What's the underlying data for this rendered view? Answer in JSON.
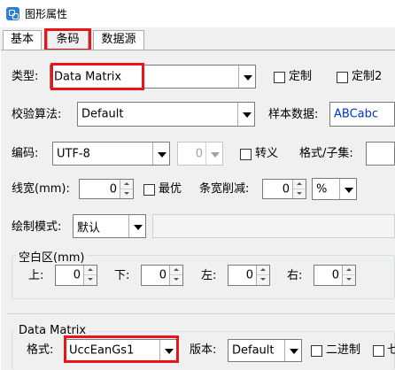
{
  "window": {
    "title": "图形属性"
  },
  "tabs": [
    {
      "label": "基本"
    },
    {
      "label": "条码"
    },
    {
      "label": "数据源"
    }
  ],
  "barcode": {
    "type_label": "类型:",
    "type_value": "Data Matrix",
    "custom_label": "定制",
    "custom2_label": "定制2",
    "check_label": "校验算法:",
    "check_value": "Default",
    "sample_label": "样本数据:",
    "sample_value": "ABCabc",
    "encoding_label": "编码:",
    "encoding_value": "UTF-8",
    "encoding_num": "0",
    "escape_label": "转义",
    "format_subset_label": "格式/子集:",
    "line_width_label": "线宽(mm):",
    "line_width_value": "0",
    "optimal_label": "最优",
    "bar_reduce_label": "条宽削减:",
    "bar_reduce_value": "0",
    "bar_reduce_unit": "%",
    "draw_mode_label": "绘制模式:",
    "draw_mode_value": "默认"
  },
  "quiet_zone": {
    "title": "空白区(mm)",
    "top_label": "上:",
    "top_value": "0",
    "bottom_label": "下:",
    "bottom_value": "0",
    "left_label": "左:",
    "left_value": "0",
    "right_label": "右:",
    "right_value": "0"
  },
  "datamatrix": {
    "title": "Data Matrix",
    "format_label": "格式:",
    "format_value": "UccEanGs1",
    "version_label": "版本:",
    "version_value": "Default",
    "binary_label": "二进制",
    "more_label": "七"
  },
  "colors": {
    "highlight": "#e8161b",
    "sample_text": "#0033cc",
    "panel": "#f0f0f0",
    "app_icon": "#2d7fd3"
  }
}
